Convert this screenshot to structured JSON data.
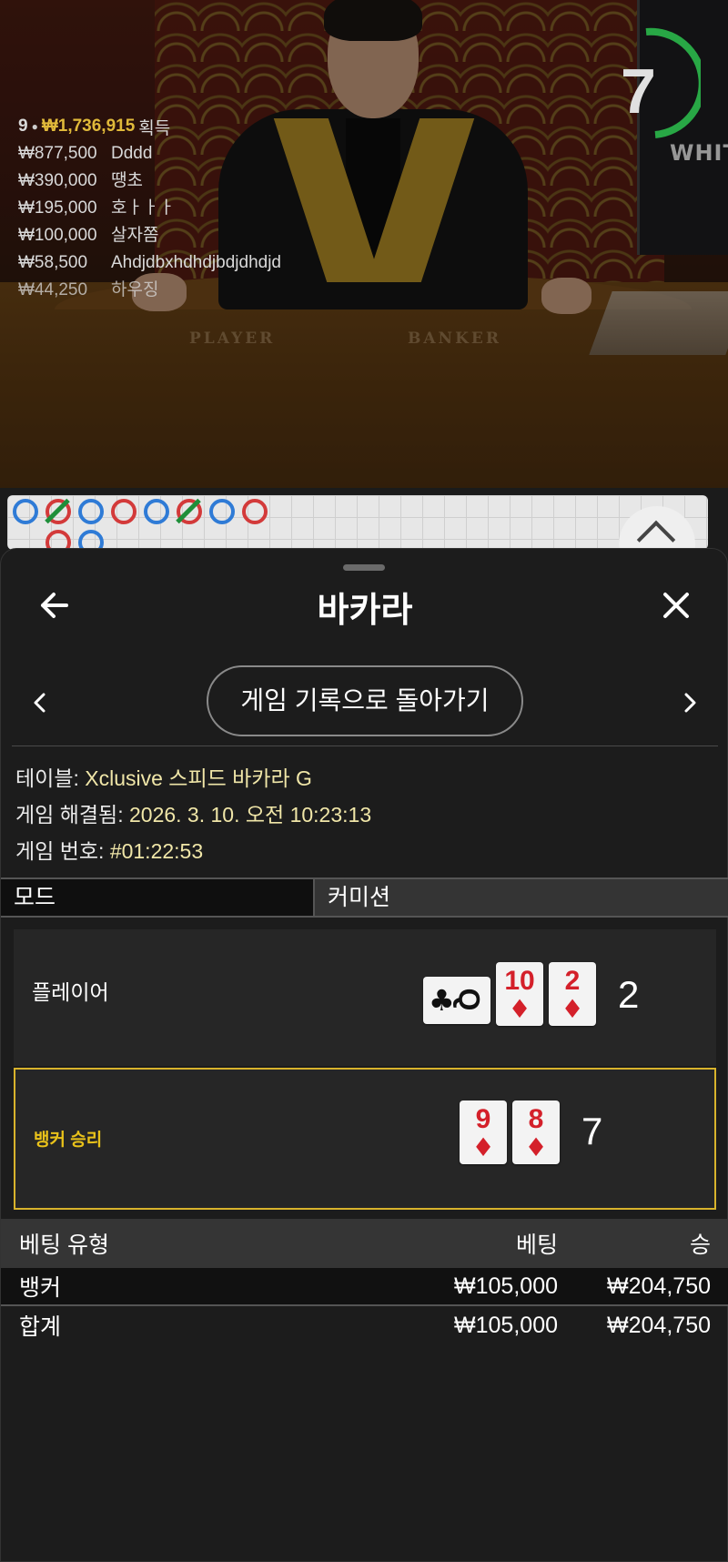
{
  "video": {
    "table_player_label": "PLAYER",
    "table_banker_label": "BANKER",
    "monitor_text": "WHIT",
    "timer_value": "7",
    "winners": {
      "count": "9",
      "total": "₩1,736,915",
      "suffix": "획득",
      "rows": [
        {
          "amount": "₩877,500",
          "name": "Dddd"
        },
        {
          "amount": "₩390,000",
          "name": "땡초"
        },
        {
          "amount": "₩195,000",
          "name": "호ㅏㅏㅏ"
        },
        {
          "amount": "₩100,000",
          "name": "살자쫌"
        },
        {
          "amount": "₩58,500",
          "name": "Ahdjdbxhdhdjbdjdhdjd"
        },
        {
          "amount": "₩44,250",
          "name": "하우징"
        }
      ]
    }
  },
  "road": {
    "colors": {
      "blue": "#2f7bd6",
      "red": "#d33a3a",
      "tie": "#1f8f3a"
    }
  },
  "sheet": {
    "title": "바카라",
    "history_button": "게임 기록으로 돌아가기",
    "info": {
      "table_label": "테이블:",
      "table_value": "Xclusive 스피드 바카라 G",
      "resolved_label": "게임 해결됨:",
      "resolved_value": "2026. 3. 10. 오전 10:23:13",
      "number_label": "게임 번호:",
      "number_value": "#01:22:53"
    },
    "mode": {
      "left": "모드",
      "right": "커미션"
    },
    "player": {
      "label": "플레이어",
      "score": "2",
      "cards": [
        {
          "rank": "Q",
          "suit": "♣"
        },
        {
          "rank": "10",
          "suit": "♦"
        },
        {
          "rank": "2",
          "suit": "♦"
        }
      ]
    },
    "banker": {
      "label": "뱅커 승리",
      "score": "7",
      "cards": [
        {
          "rank": "9",
          "suit": "♦"
        },
        {
          "rank": "8",
          "suit": "♦"
        }
      ]
    },
    "bets": {
      "headers": {
        "type": "베팅 유형",
        "bet": "베팅",
        "win": "승"
      },
      "rows": [
        {
          "type": "뱅커",
          "bet": "₩105,000",
          "win": "₩204,750"
        },
        {
          "type": "합계",
          "bet": "₩105,000",
          "win": "₩204,750"
        }
      ]
    },
    "accent": "#e9c21a"
  }
}
